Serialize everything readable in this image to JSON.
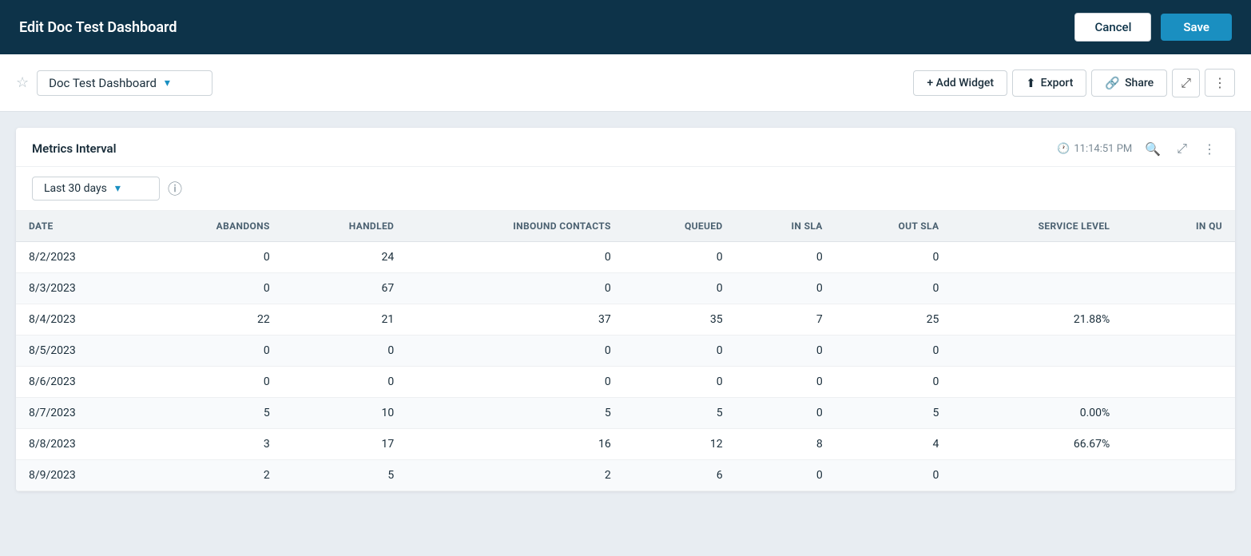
{
  "header": {
    "title": "Edit Doc Test Dashboard",
    "cancel_label": "Cancel",
    "save_label": "Save"
  },
  "toolbar": {
    "dashboard_name": "Doc Test Dashboard",
    "add_widget_label": "+ Add Widget",
    "export_label": "Export",
    "share_label": "Share"
  },
  "widget": {
    "title": "Metrics Interval",
    "timestamp": "11:14:51 PM",
    "interval_label": "Last 30 days"
  },
  "table": {
    "columns": [
      "DATE",
      "ABANDONS",
      "HANDLED",
      "INBOUND CONTACTS",
      "QUEUED",
      "IN SLA",
      "OUT SLA",
      "SERVICE LEVEL",
      "IN QU"
    ],
    "rows": [
      {
        "date": "8/2/2023",
        "abandons": "0",
        "handled": "24",
        "inbound": "0",
        "queued": "0",
        "in_sla": "0",
        "out_sla": "0",
        "service_level": "",
        "in_qu": ""
      },
      {
        "date": "8/3/2023",
        "abandons": "0",
        "handled": "67",
        "inbound": "0",
        "queued": "0",
        "in_sla": "0",
        "out_sla": "0",
        "service_level": "",
        "in_qu": ""
      },
      {
        "date": "8/4/2023",
        "abandons": "22",
        "handled": "21",
        "inbound": "37",
        "queued": "35",
        "in_sla": "7",
        "out_sla": "25",
        "service_level": "21.88%",
        "in_qu": ""
      },
      {
        "date": "8/5/2023",
        "abandons": "0",
        "handled": "0",
        "inbound": "0",
        "queued": "0",
        "in_sla": "0",
        "out_sla": "0",
        "service_level": "",
        "in_qu": ""
      },
      {
        "date": "8/6/2023",
        "abandons": "0",
        "handled": "0",
        "inbound": "0",
        "queued": "0",
        "in_sla": "0",
        "out_sla": "0",
        "service_level": "",
        "in_qu": ""
      },
      {
        "date": "8/7/2023",
        "abandons": "5",
        "handled": "10",
        "inbound": "5",
        "queued": "5",
        "in_sla": "0",
        "out_sla": "5",
        "service_level": "0.00%",
        "in_qu": ""
      },
      {
        "date": "8/8/2023",
        "abandons": "3",
        "handled": "17",
        "inbound": "16",
        "queued": "12",
        "in_sla": "8",
        "out_sla": "4",
        "service_level": "66.67%",
        "in_qu": ""
      },
      {
        "date": "8/9/2023",
        "abandons": "2",
        "handled": "5",
        "inbound": "2",
        "queued": "6",
        "in_sla": "0",
        "out_sla": "0",
        "service_level": "",
        "in_qu": ""
      }
    ]
  },
  "icons": {
    "star": "☆",
    "chevron_down": "▾",
    "plus": "+",
    "export": "↑",
    "share": "⬡",
    "expand": "⤢",
    "more_vert": "⋮",
    "clock": "🕐",
    "search": "🔍",
    "fullscreen": "⤢",
    "info": "ⓘ"
  }
}
